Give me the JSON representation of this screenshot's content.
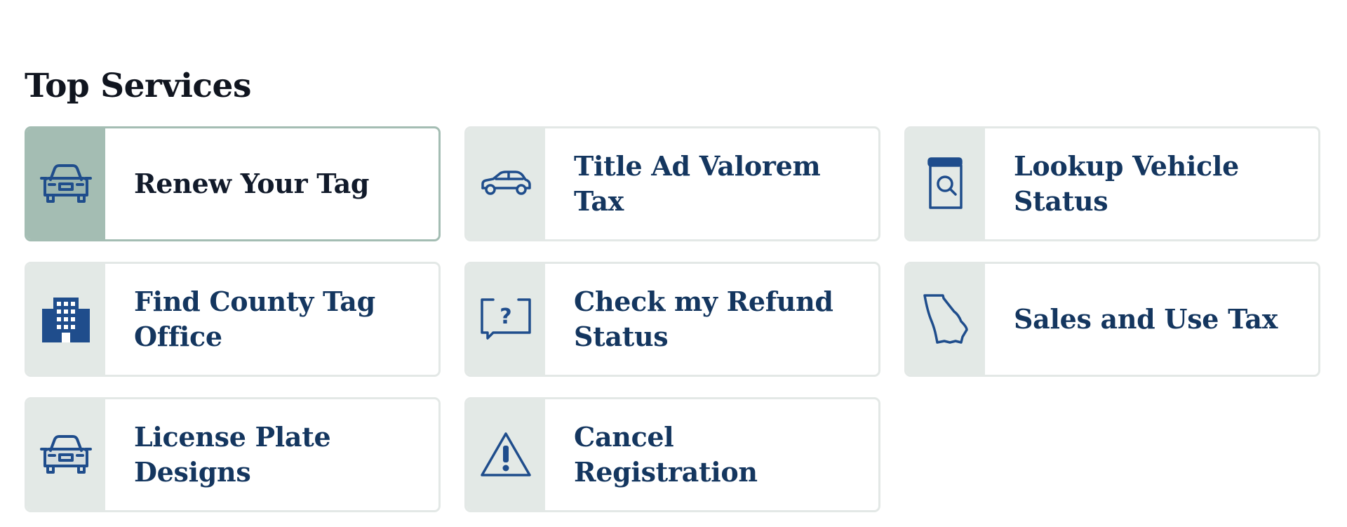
{
  "section": {
    "title": "Top Services"
  },
  "services": [
    {
      "label": "Renew Your Tag",
      "icon": "car-front-icon",
      "active": true
    },
    {
      "label": "Title Ad Valorem Tax",
      "icon": "car-side-icon",
      "active": false
    },
    {
      "label": "Lookup Vehicle Status",
      "icon": "document-search-icon",
      "active": false
    },
    {
      "label": "Find County Tag Office",
      "icon": "office-building-icon",
      "active": false
    },
    {
      "label": "Check my Refund Status",
      "icon": "question-bubble-icon",
      "active": false
    },
    {
      "label": "Sales and Use Tax",
      "icon": "georgia-map-icon",
      "active": false
    },
    {
      "label": "License Plate Designs",
      "icon": "car-front-icon",
      "active": false
    },
    {
      "label": "Cancel Registration",
      "icon": "warning-triangle-icon",
      "active": false
    }
  ],
  "colors": {
    "label_text": "#14365f",
    "icon_blue": "#1f4d8c",
    "icon_panel": "#e3e9e6",
    "active_panel": "#a4bdb3",
    "card_border": "#e3e8e6"
  }
}
